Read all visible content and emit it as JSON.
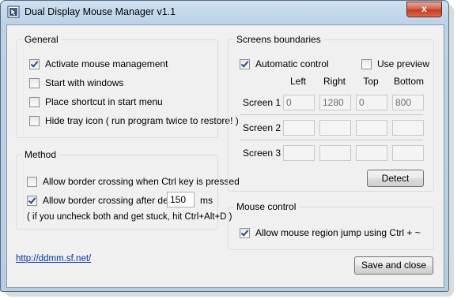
{
  "window": {
    "title": "Dual Display Mouse Manager v1.1",
    "close_glyph": "x"
  },
  "general": {
    "legend": "General",
    "options": [
      {
        "label": "Activate mouse management",
        "checked": true
      },
      {
        "label": "Start with windows",
        "checked": false
      },
      {
        "label": "Place shortcut in start menu",
        "checked": false
      },
      {
        "label": "Hide tray icon ( run program twice to restore! )",
        "checked": false
      }
    ]
  },
  "method": {
    "legend": "Method",
    "ctrl_crossing": {
      "label": "Allow border crossing when Ctrl key is pressed",
      "checked": false
    },
    "delay_crossing": {
      "label": "Allow border crossing after delay:",
      "checked": true,
      "value": "150",
      "unit": "ms"
    },
    "note": "( if you uncheck both and get stuck, hit Ctrl+Alt+D )"
  },
  "screens": {
    "legend": "Screens boundaries",
    "automatic_control": {
      "label": "Automatic control",
      "checked": true
    },
    "use_preview": {
      "label": "Use preview",
      "checked": false
    },
    "columns": [
      "Left",
      "Right",
      "Top",
      "Bottom"
    ],
    "rows": [
      {
        "label": "Screen 1",
        "values": [
          "0",
          "1280",
          "0",
          "800"
        ]
      },
      {
        "label": "Screen 2",
        "values": [
          "",
          "",
          "",
          ""
        ]
      },
      {
        "label": "Screen 3",
        "values": [
          "",
          "",
          "",
          ""
        ]
      }
    ],
    "detect_label": "Detect"
  },
  "mouse_control": {
    "legend": "Mouse control",
    "region_jump": {
      "label": "Allow mouse region jump using Ctrl + ~",
      "checked": true
    }
  },
  "footer": {
    "link": "http://ddmm.sf.net/",
    "save_close_label": "Save and close"
  }
}
